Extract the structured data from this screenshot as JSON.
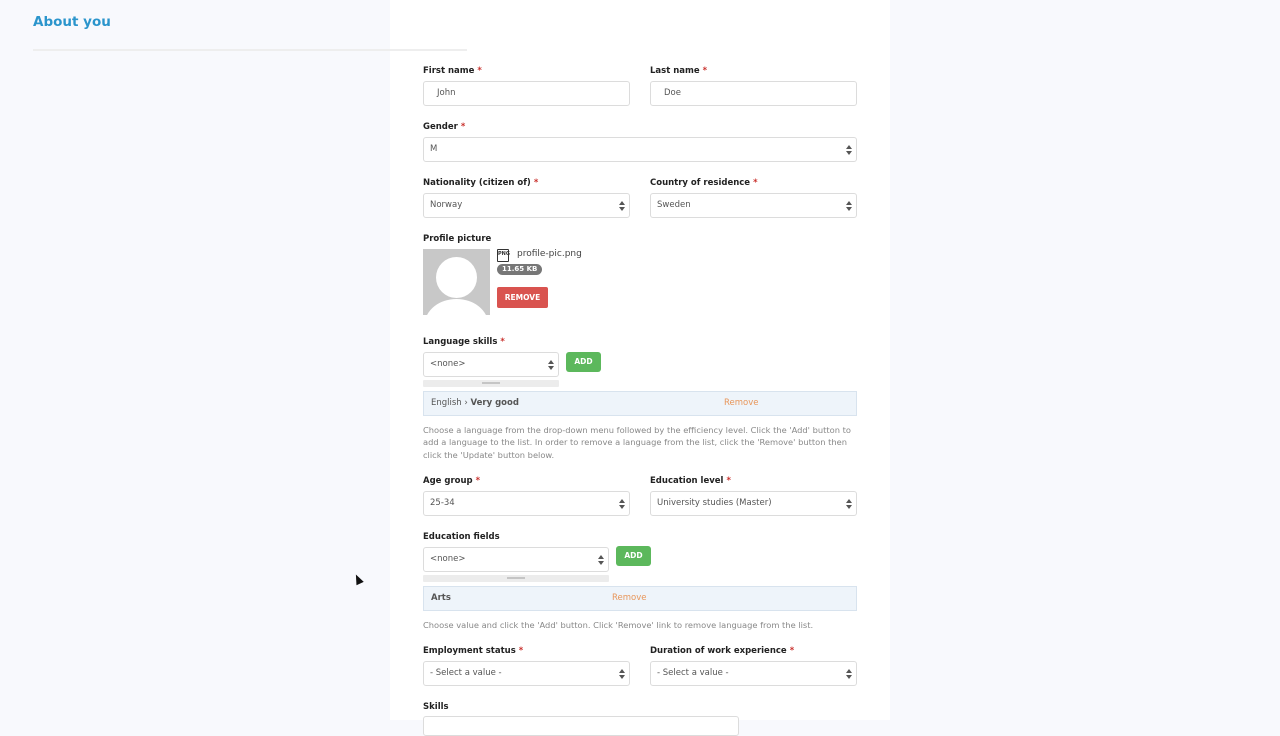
{
  "section": {
    "title": "About you"
  },
  "required_marker": "*",
  "first_name": {
    "label": "First name",
    "value": "John"
  },
  "last_name": {
    "label": "Last name",
    "value": "Doe"
  },
  "gender": {
    "label": "Gender",
    "value": "M"
  },
  "nationality": {
    "label": "Nationality (citizen of)",
    "value": "Norway"
  },
  "country": {
    "label": "Country of residence",
    "value": "Sweden"
  },
  "profile_picture": {
    "label": "Profile picture",
    "file_icon": "PNG",
    "filename": "profile-pic.png",
    "filesize": "11.65 KB",
    "remove_label": "REMOVE"
  },
  "language_skills": {
    "label": "Language skills",
    "select_value": "<none>",
    "add_label": "ADD",
    "items": [
      {
        "language": "English",
        "separator": "›",
        "level": "Very good",
        "remove_label": "Remove"
      }
    ],
    "help": "Choose a language from the drop-down menu followed by the efficiency level. Click the 'Add' button to add a language to the list. In order to remove a language from the list, click the 'Remove' button then click the 'Update' button below."
  },
  "age_group": {
    "label": "Age group",
    "value": "25-34"
  },
  "education_level": {
    "label": "Education level",
    "value": "University studies (Master)"
  },
  "education_fields": {
    "label": "Education fields",
    "select_value": "<none>",
    "add_label": "ADD",
    "items": [
      {
        "name": "Arts",
        "remove_label": "Remove"
      }
    ],
    "help": "Choose value and click the 'Add' button. Click 'Remove' link to remove language from the list."
  },
  "employment_status": {
    "label": "Employment status",
    "value": "- Select a value -"
  },
  "work_experience": {
    "label": "Duration of work experience",
    "value": "- Select a value -"
  },
  "skills": {
    "label": "Skills"
  }
}
